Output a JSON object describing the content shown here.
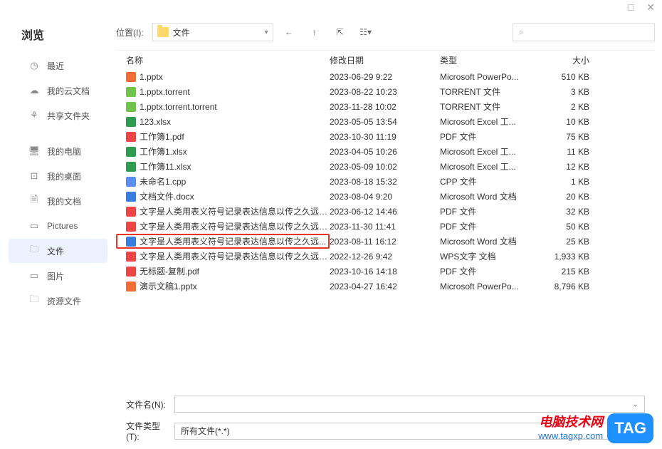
{
  "titlebar": {
    "maximize_glyph": "□",
    "close_glyph": "✕"
  },
  "sidebar": {
    "title": "浏览",
    "group1": [
      {
        "icon": "◷",
        "label": "最近",
        "name": "nav-recent",
        "active": false
      },
      {
        "icon": "☁",
        "label": "我的云文档",
        "name": "nav-cloud",
        "active": false
      },
      {
        "icon": "⚘",
        "label": "共享文件夹",
        "name": "nav-shared",
        "active": false
      }
    ],
    "group2": [
      {
        "icon": "🖥",
        "label": "我的电脑",
        "name": "nav-computer",
        "active": false
      },
      {
        "icon": "⊡",
        "label": "我的桌面",
        "name": "nav-desktop",
        "active": false
      },
      {
        "icon": "🗎",
        "label": "我的文档",
        "name": "nav-documents",
        "active": false
      },
      {
        "icon": "▭",
        "label": "Pictures",
        "name": "nav-pictures",
        "active": false
      },
      {
        "icon": "🗀",
        "label": "文件",
        "name": "nav-files",
        "active": true
      },
      {
        "icon": "▭",
        "label": "图片",
        "name": "nav-images",
        "active": false
      },
      {
        "icon": "🗀",
        "label": "资源文件",
        "name": "nav-resources",
        "active": false
      }
    ]
  },
  "toolbar": {
    "location_label": "位置(I):",
    "current_folder": "文件",
    "back_glyph": "←",
    "up_glyph": "↑",
    "newwin_glyph": "⇱",
    "view_glyph": "☷▾"
  },
  "columns": {
    "name": "名称",
    "date": "修改日期",
    "type": "类型",
    "size": "大小"
  },
  "files": [
    {
      "icon": "ic-ppt",
      "name": "1.pptx",
      "date": "2023-06-29 9:22",
      "type": "Microsoft PowerPo...",
      "size": "510 KB",
      "hl": false
    },
    {
      "icon": "ic-tor",
      "name": "1.pptx.torrent",
      "date": "2023-08-22 10:23",
      "type": "TORRENT 文件",
      "size": "3 KB",
      "hl": false
    },
    {
      "icon": "ic-tor",
      "name": "1.pptx.torrent.torrent",
      "date": "2023-11-28 10:02",
      "type": "TORRENT 文件",
      "size": "2 KB",
      "hl": false
    },
    {
      "icon": "ic-xls",
      "name": "123.xlsx",
      "date": "2023-05-05 13:54",
      "type": "Microsoft Excel 工...",
      "size": "10 KB",
      "hl": false
    },
    {
      "icon": "ic-pdf",
      "name": "工作簿1.pdf",
      "date": "2023-10-30 11:19",
      "type": "PDF 文件",
      "size": "75 KB",
      "hl": false
    },
    {
      "icon": "ic-xls",
      "name": "工作簿1.xlsx",
      "date": "2023-04-05 10:26",
      "type": "Microsoft Excel 工...",
      "size": "11 KB",
      "hl": false
    },
    {
      "icon": "ic-xls",
      "name": "工作簿11.xlsx",
      "date": "2023-05-09 10:02",
      "type": "Microsoft Excel 工...",
      "size": "12 KB",
      "hl": false
    },
    {
      "icon": "ic-cpp",
      "name": "未命名1.cpp",
      "date": "2023-08-18 15:32",
      "type": "CPP 文件",
      "size": "1 KB",
      "hl": false
    },
    {
      "icon": "ic-doc",
      "name": "文档文件.docx",
      "date": "2023-08-04 9:20",
      "type": "Microsoft Word 文档",
      "size": "20 KB",
      "hl": false
    },
    {
      "icon": "ic-pdf",
      "name": "文字是人类用表义符号记录表达信息以传之久远的...",
      "date": "2023-06-12 14:46",
      "type": "PDF 文件",
      "size": "32 KB",
      "hl": false
    },
    {
      "icon": "ic-pdf",
      "name": "文字是人类用表义符号记录表达信息以传之久远的...",
      "date": "2023-11-30 11:41",
      "type": "PDF 文件",
      "size": "50 KB",
      "hl": false
    },
    {
      "icon": "ic-doc",
      "name": "文字是人类用表义符号记录表达信息以传之久远...",
      "date": "2023-08-11 16:12",
      "type": "Microsoft Word 文档",
      "size": "25 KB",
      "hl": true
    },
    {
      "icon": "ic-wps",
      "name": "文字是人类用表义符号记录表达信息以传之久远的...",
      "date": "2022-12-26 9:42",
      "type": "WPS文字 文档",
      "size": "1,933 KB",
      "hl": false
    },
    {
      "icon": "ic-pdf",
      "name": "无标题-复制.pdf",
      "date": "2023-10-16 14:18",
      "type": "PDF 文件",
      "size": "215 KB",
      "hl": false
    },
    {
      "icon": "ic-ppt",
      "name": "演示文稿1.pptx",
      "date": "2023-04-27 16:42",
      "type": "Microsoft PowerPo...",
      "size": "8,796 KB",
      "hl": false
    }
  ],
  "form": {
    "filename_label": "文件名(N):",
    "filename_value": "",
    "filetype_label": "文件类型(T):",
    "filetype_value": "所有文件(*.*)"
  },
  "watermark": {
    "line1": "电脑技术网",
    "line2": "www.tagxp.com",
    "tag": "TAG"
  }
}
